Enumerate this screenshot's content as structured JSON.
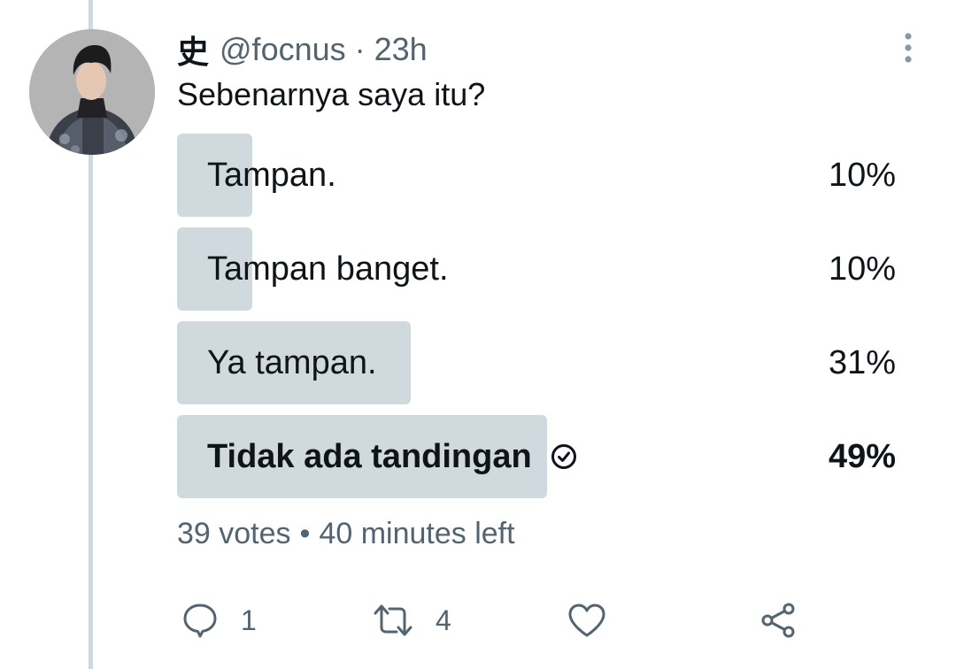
{
  "tweet": {
    "display_name": "史",
    "handle": "@focnus",
    "separator": "·",
    "time": "23h",
    "text": "Sebenarnya saya itu?"
  },
  "poll": {
    "options": [
      {
        "label": "Tampan.",
        "percent": 10,
        "percent_text": "10%",
        "winner": false
      },
      {
        "label": "Tampan banget.",
        "percent": 10,
        "percent_text": "10%",
        "winner": false
      },
      {
        "label": "Ya tampan.",
        "percent": 31,
        "percent_text": "31%",
        "winner": false
      },
      {
        "label": "Tidak ada tandingan",
        "percent": 49,
        "percent_text": "49%",
        "winner": true
      }
    ],
    "votes": "39 votes",
    "meta_separator": "•",
    "time_left": "40 minutes left"
  },
  "actions": {
    "reply_count": "1",
    "retweet_count": "4",
    "like_count": "",
    "share_count": ""
  },
  "icons": [
    "more-vertical-icon",
    "check-circle-icon",
    "reply-icon",
    "retweet-icon",
    "like-icon",
    "share-icon"
  ],
  "colors": {
    "text_primary": "#0f1419",
    "text_secondary": "#536471",
    "poll_bar": "#cfd9de",
    "thread_line": "#cfd9de"
  }
}
